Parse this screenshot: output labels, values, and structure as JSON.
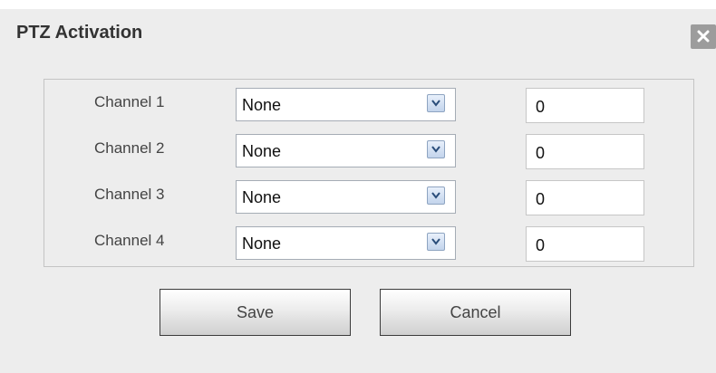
{
  "dialog": {
    "title": "PTZ Activation",
    "close_icon": "close-x-icon"
  },
  "channels": [
    {
      "label": "Channel 1",
      "selected": "None",
      "value": "0"
    },
    {
      "label": "Channel 2",
      "selected": "None",
      "value": "0"
    },
    {
      "label": "Channel 3",
      "selected": "None",
      "value": "0"
    },
    {
      "label": "Channel 4",
      "selected": "None",
      "value": "0"
    }
  ],
  "buttons": {
    "save_label": "Save",
    "cancel_label": "Cancel"
  },
  "colors": {
    "dialog_background": "#ededed",
    "close_button": "#9c9c9c",
    "select_arrow_tint": "#c3d4ec"
  }
}
